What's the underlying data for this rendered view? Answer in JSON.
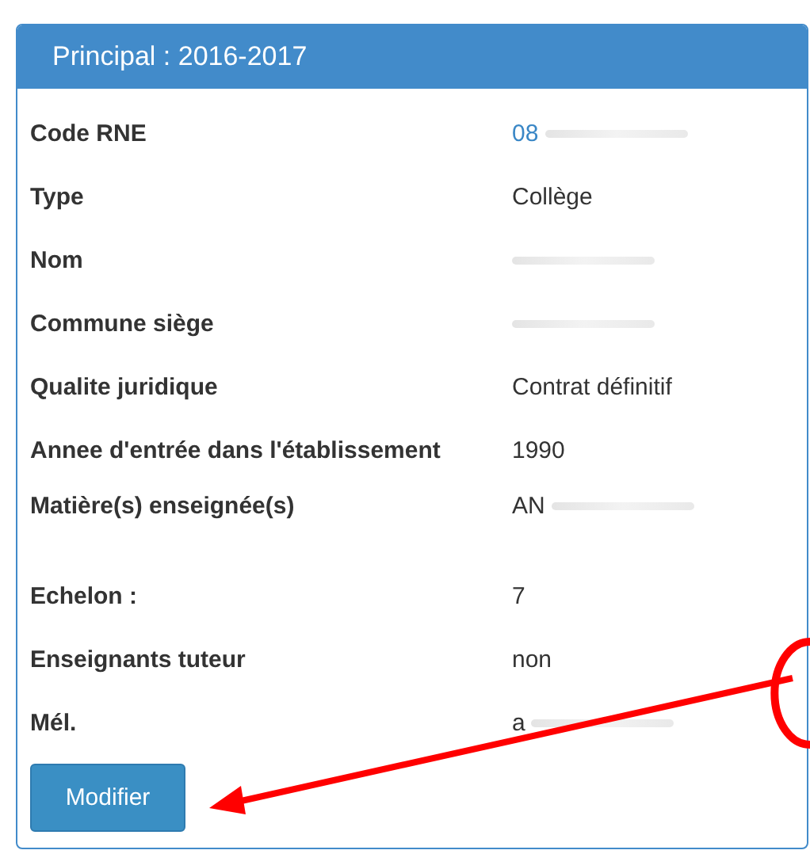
{
  "panel": {
    "title": "Principal : 2016-2017"
  },
  "rows": [
    {
      "label": "Code RNE",
      "value": "08",
      "kind": "redacted-link"
    },
    {
      "label": "Type",
      "value": "Collège",
      "kind": "text"
    },
    {
      "label": "Nom",
      "kind": "redacted"
    },
    {
      "label": "Commune siège",
      "kind": "redacted"
    },
    {
      "label": "Qualite juridique",
      "value": "Contrat définitif",
      "kind": "text"
    },
    {
      "label": "Annee d'entrée dans l'établissement",
      "value": "1990",
      "kind": "text"
    },
    {
      "label": "Matière(s) enseignée(s)",
      "value": "AN",
      "kind": "redacted-tall"
    },
    {
      "label": "Echelon :",
      "value": "7",
      "kind": "text"
    },
    {
      "label": "Enseignants tuteur",
      "value": "non",
      "kind": "text"
    },
    {
      "label": "Mél.",
      "value": "a",
      "kind": "redacted"
    }
  ],
  "button": {
    "label": "Modifier"
  }
}
